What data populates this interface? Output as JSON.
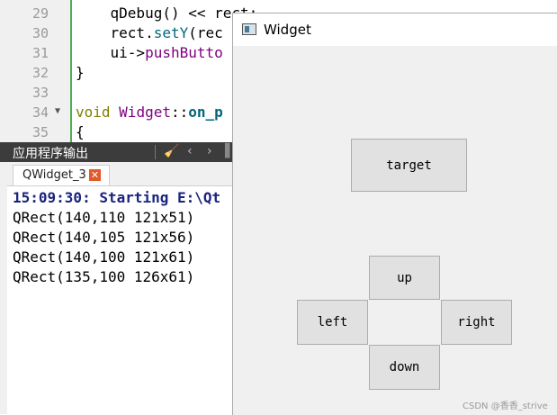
{
  "editor": {
    "line_numbers": [
      "29",
      "30",
      "31",
      "32",
      "33",
      "34",
      "35"
    ],
    "code": {
      "l29_a": "    qDebug() << rect;",
      "l30_a": "    rect.",
      "l30_b": "setY",
      "l30_c": "(rec",
      "l31_a": "    ui->",
      "l31_b": "pushButto",
      "l32": "}",
      "l34_a": "void ",
      "l34_b": "Widget",
      "l34_c": "::",
      "l34_d": "on_p",
      "l35": "{"
    }
  },
  "output_pane": {
    "title": "应用程序输出",
    "tab_label": "QWidget_3",
    "tab_close": "✕",
    "lines": [
      "15:09:30: Starting E:\\Qt",
      "QRect(140,110 121x51)",
      "QRect(140,105 121x56)",
      "QRect(140,100 121x61)",
      "QRect(135,100 126x61)"
    ]
  },
  "widget_window": {
    "title": "Widget",
    "buttons": {
      "target": "target",
      "up": "up",
      "left": "left",
      "right": "right",
      "down": "down"
    }
  },
  "watermark": "CSDN @香香_strive",
  "colors": {
    "gutter_rule": "#4caf50",
    "output_header": "#3c3c3c",
    "starting_line": "#1a237e",
    "tab_close": "#e05a2a"
  }
}
